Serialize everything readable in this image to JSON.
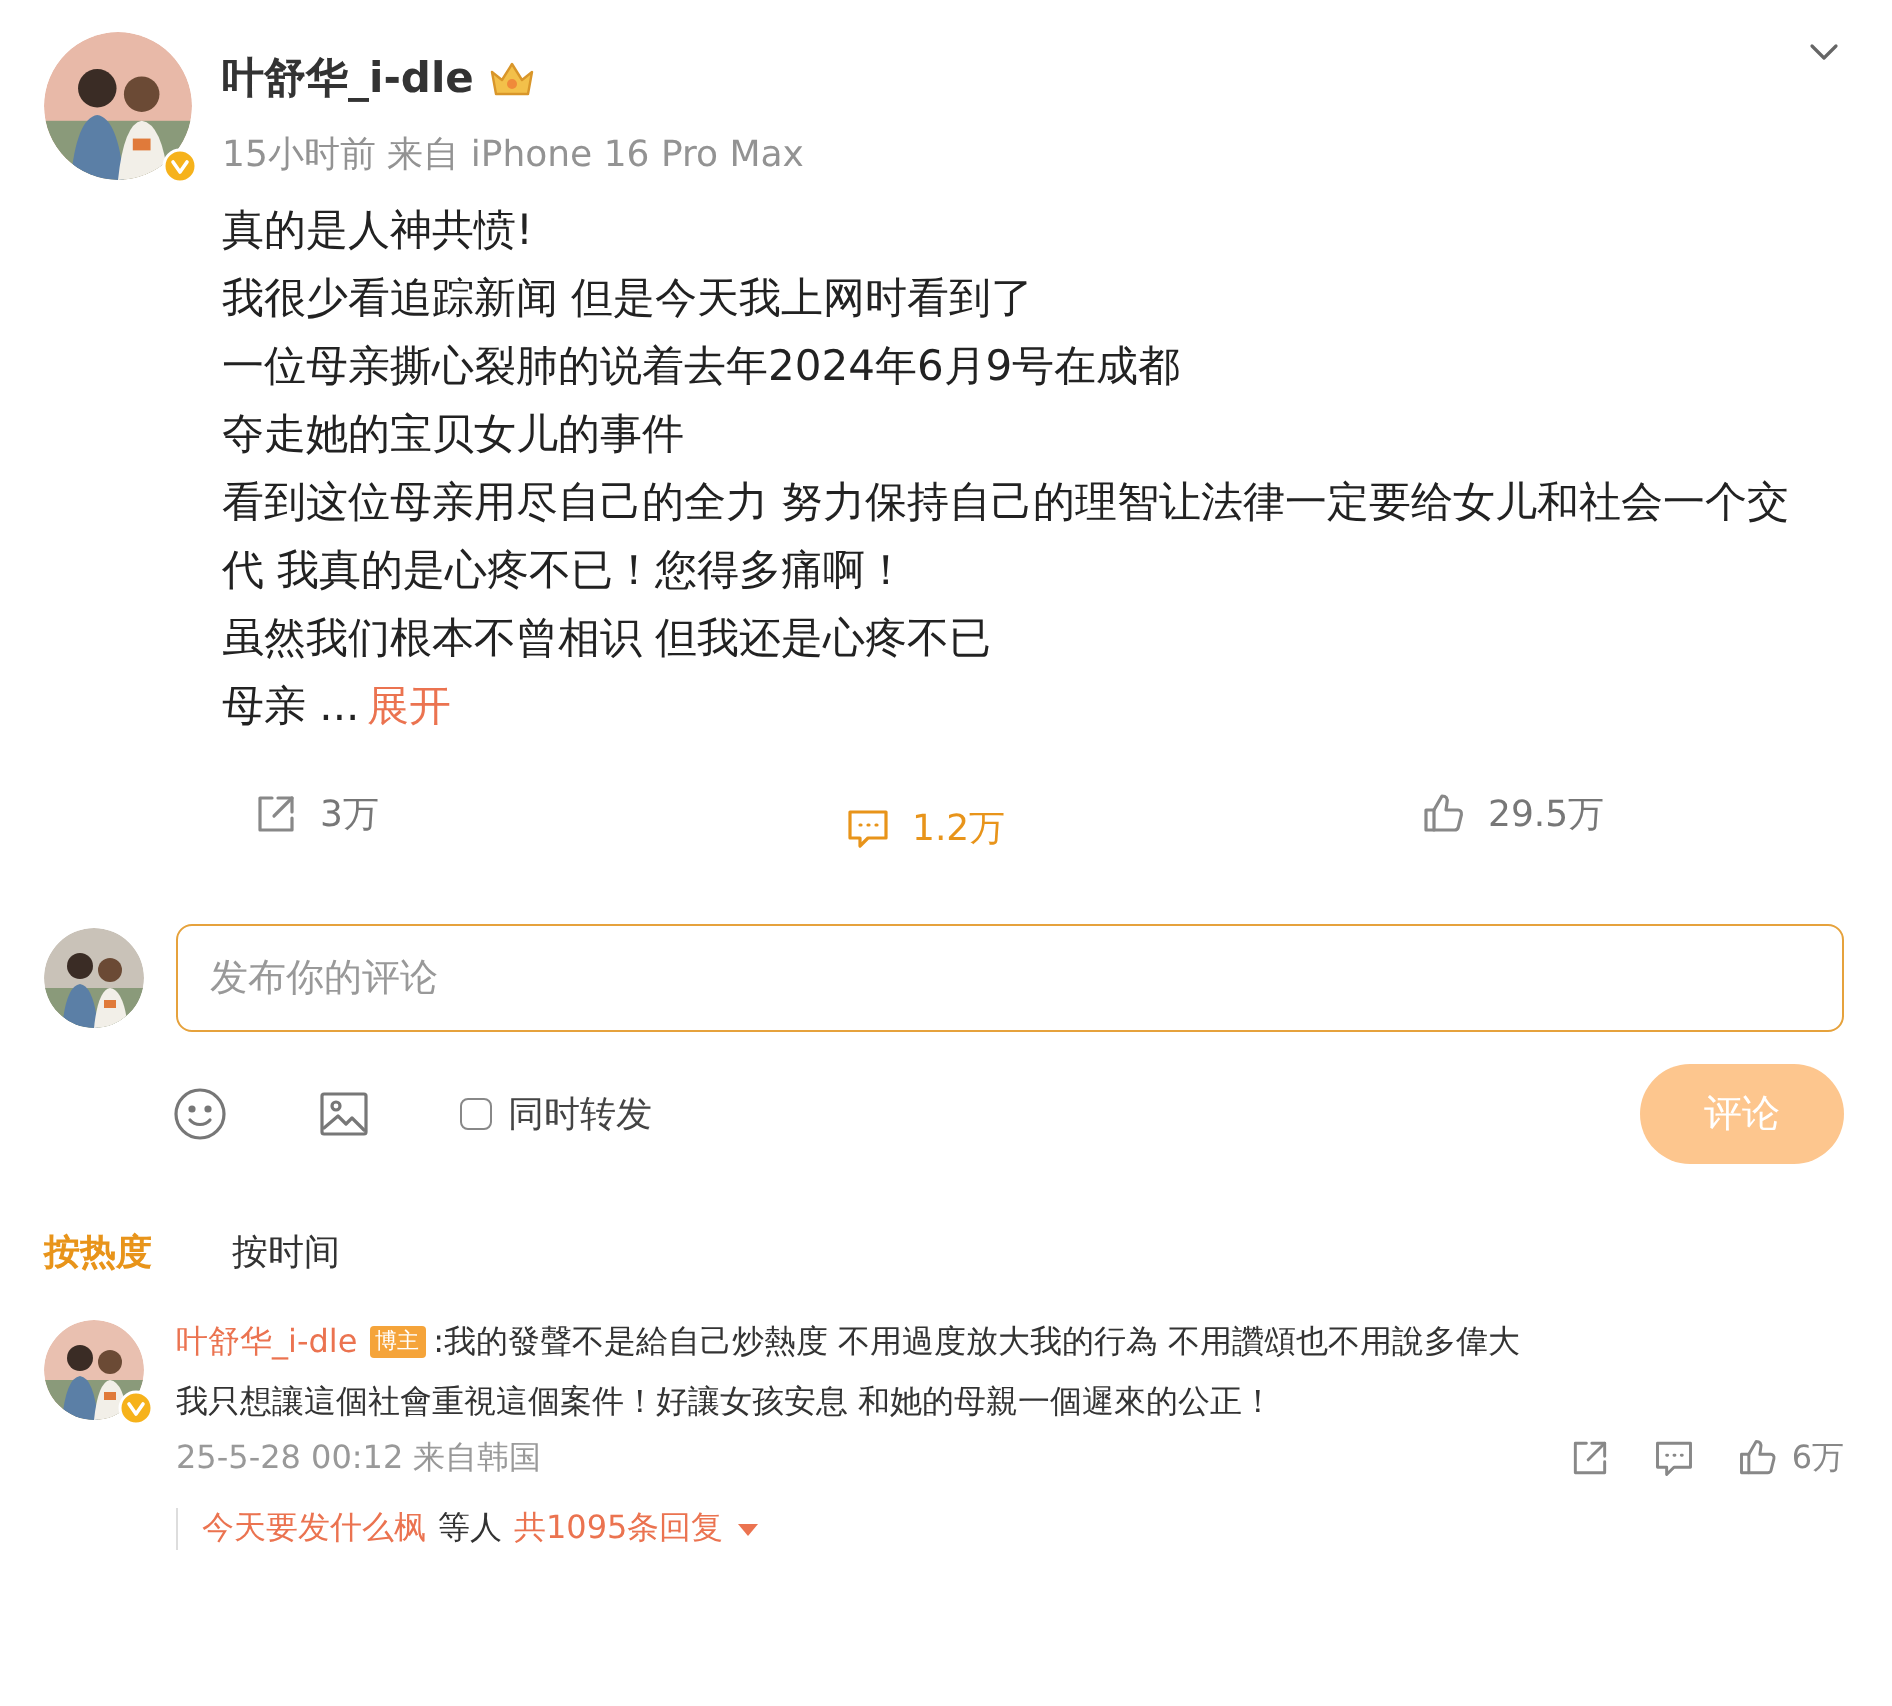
{
  "post": {
    "author": "叶舒华_i-dle",
    "meta": "15小时前 来自 iPhone 16 Pro Max",
    "lines": [
      "真的是人神共愤!",
      "我很少看追踪新闻 但是今天我上网时看到了",
      "一位母亲撕心裂肺的说着去年2024年6月9号在成都",
      "夺走她的宝贝女儿的事件",
      "看到这位母亲用尽自己的全力 努力保持自己的理智让法律一定要给女儿和社会一个交代 我真的是心疼不已！您得多痛啊！",
      "虽然我们根本不曾相识 但我还是心疼不已"
    ],
    "last_line": "母亲  ...",
    "expand": "展开",
    "actions": [
      {
        "kind": "share",
        "count": "3万",
        "selected": false
      },
      {
        "kind": "comment",
        "count": "1.2万",
        "selected": true
      },
      {
        "kind": "like",
        "count": "29.5万",
        "selected": false
      }
    ]
  },
  "composer": {
    "placeholder": "发布你的评论",
    "repost": {
      "label": "同时转发",
      "checked": false
    },
    "submit": "评论"
  },
  "sort_tabs": [
    {
      "label": "按热度",
      "selected": true
    },
    {
      "label": "按时间",
      "selected": false
    }
  ],
  "comments": [
    {
      "author": "叶舒华_i-dle",
      "badge": "博主",
      "lines": [
        ":我的發聲不是給自己炒熱度 不用過度放大我的行為 不用讚頌也不用說多偉大",
        "我只想讓這個社會重視這個案件！好讓女孩安息 和她的母親一個遲來的公正！"
      ],
      "time": "25-5-28 00:12 来自韩国",
      "likes": "6万",
      "replies": {
        "first": "今天要发什么枫",
        "others": "等人",
        "total": "共1095条回复"
      }
    }
  ]
}
